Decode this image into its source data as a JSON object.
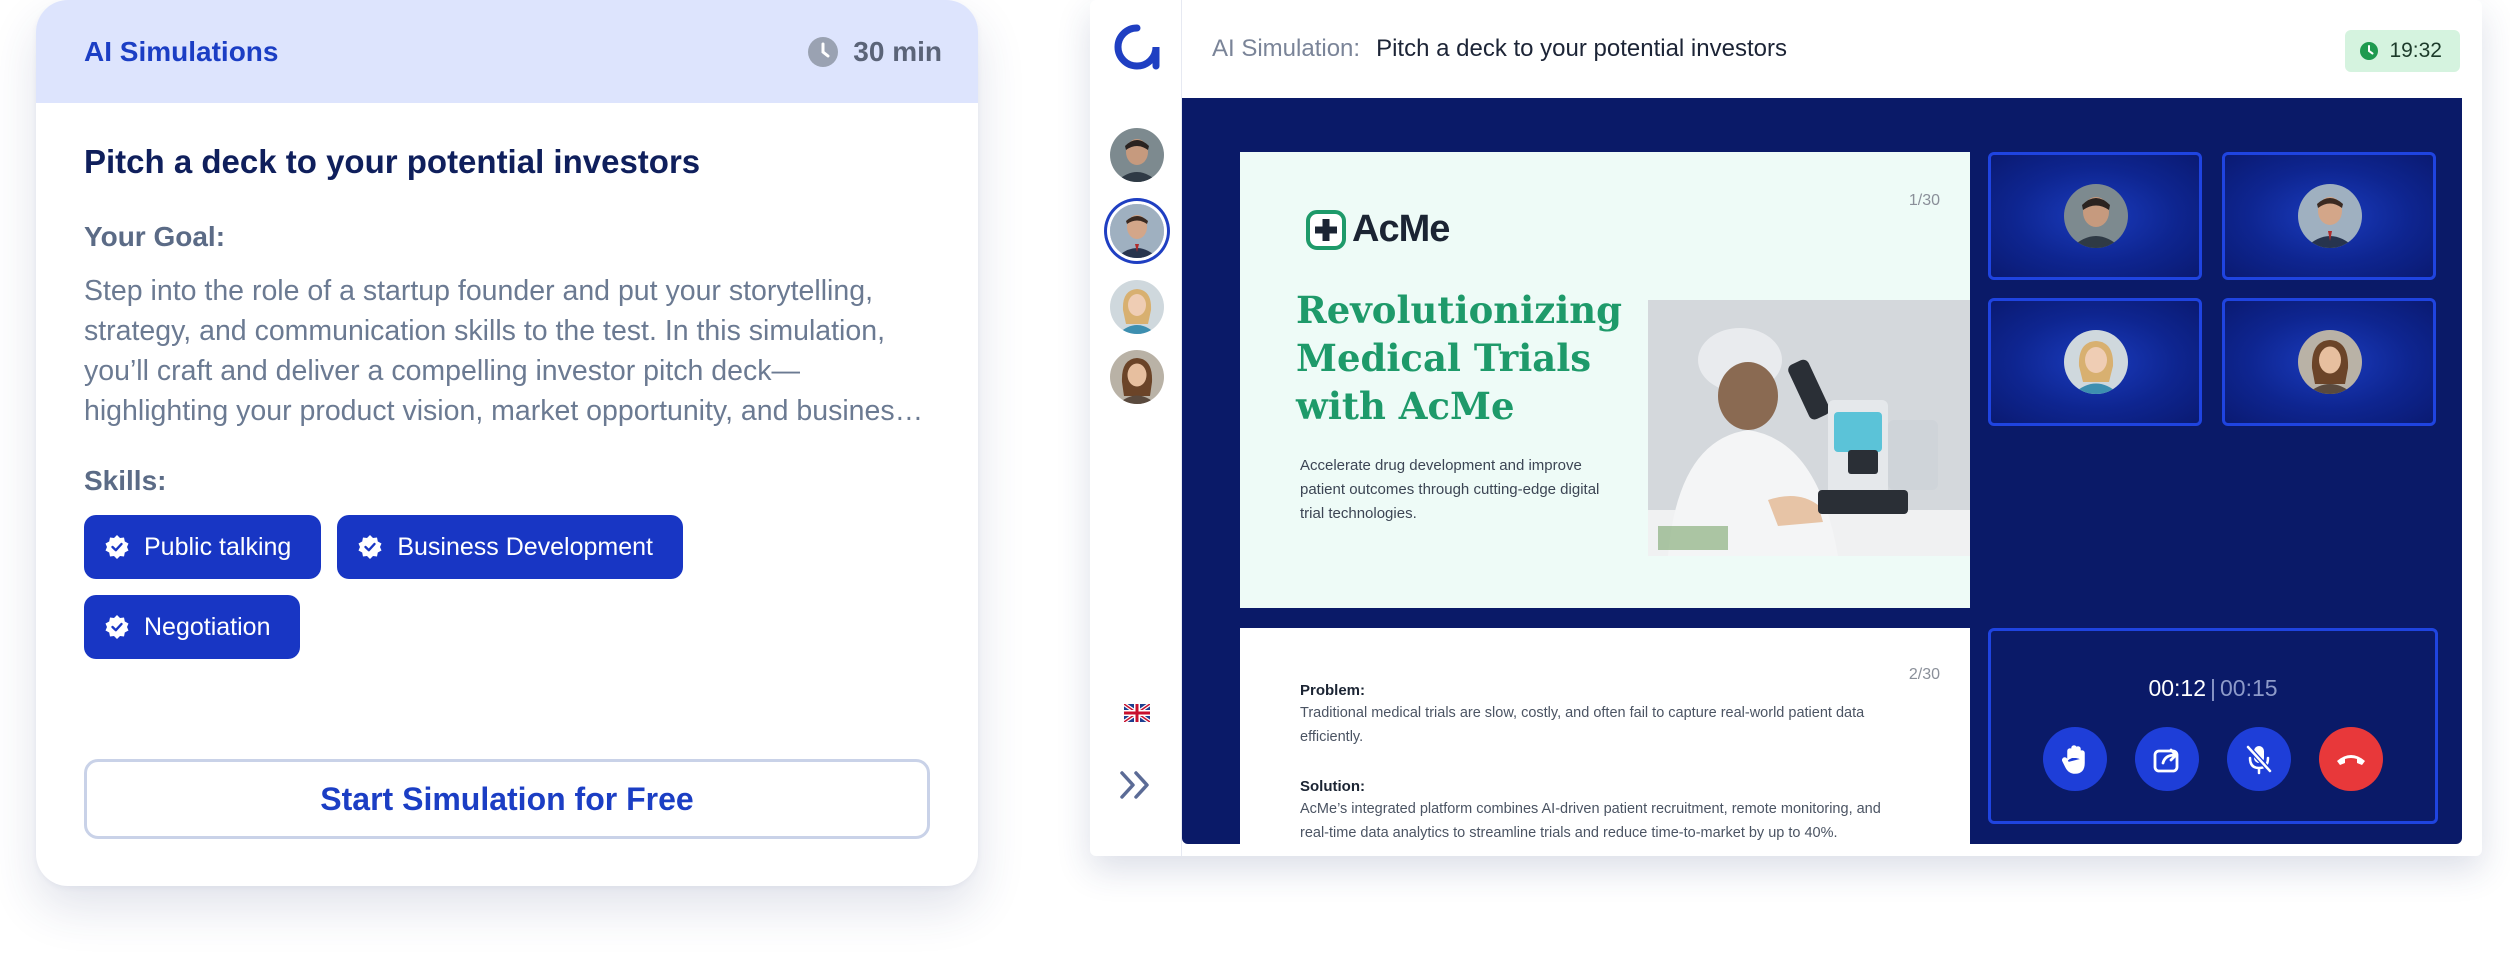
{
  "card": {
    "header_title": "AI Simulations",
    "duration": "30 min",
    "title": "Pitch a deck to your potential investors",
    "goal_label": "Your Goal:",
    "goal_text": "Step into the role of a startup founder and put your storytelling, strategy, and communication skills to the test. In this simulation, you’ll craft and deliver a compelling investor pitch deck—highlighting your product vision, market opportunity, and business model.",
    "skills_label": "Skills:",
    "skills": [
      "Public talking",
      "Business Development",
      "Negotiation"
    ],
    "start_button": "Start Simulation for Free"
  },
  "app": {
    "topbar_prefix": "AI Simulation:",
    "topbar_title": "Pitch a deck to your potential investors",
    "timer": "19:32",
    "slide1": {
      "page": "1/30",
      "brand": "AcMe",
      "headline": "Revolutionizing Medical Trials with AcMe",
      "subtext": "Accelerate drug development and improve patient outcomes through cutting-edge digital trial technologies."
    },
    "slide2": {
      "page": "2/30",
      "problem_label": "Problem:",
      "problem_text": "Traditional medical trials are slow, costly, and often fail to capture real-world patient data efficiently.",
      "solution_label": "Solution:",
      "solution_text": "AcMe’s integrated platform combines AI-driven patient recruitment, remote monitoring, and real-time data analytics to streamline trials and reduce time-to-market by up to 40%."
    },
    "call": {
      "elapsed": "00:12",
      "separator": "|",
      "limit": "00:15"
    },
    "colors": {
      "accent": "#1836c4",
      "stage": "#0a1a68",
      "slide_headline": "#1e9a6a",
      "end_call": "#e8383a",
      "timer_bg": "#d5f3df"
    },
    "icons": [
      "logo-icon",
      "flag-uk-icon",
      "expand-icon",
      "raise-hand-icon",
      "share-icon",
      "mic-off-icon",
      "end-call-icon"
    ]
  }
}
